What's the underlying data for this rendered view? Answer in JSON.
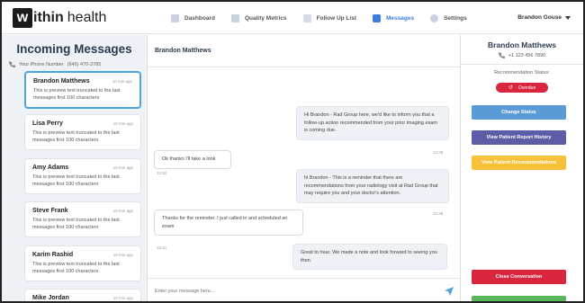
{
  "brand": {
    "logo_letter": "w",
    "logo_rest": "ithin",
    "logo_suffix": "health"
  },
  "nav": [
    {
      "label": "Dashboard",
      "icon": "dashboard-icon"
    },
    {
      "label": "Quality Metrics",
      "icon": "clipboard-icon"
    },
    {
      "label": "Follow Up List",
      "icon": "list-icon"
    },
    {
      "label": "Messages",
      "icon": "chat-icon",
      "active": true
    },
    {
      "label": "Settings",
      "icon": "gear-icon"
    }
  ],
  "user": {
    "name": "Brandon Gouse"
  },
  "inbox": {
    "title": "Incoming Messages",
    "phone_label": "Your Phone Number",
    "phone_number": "(646) 470-3785",
    "items": [
      {
        "name": "Brandon Matthews",
        "time": "10 min ago",
        "preview": "This is preview text truncated to the last messages first 100 characters"
      },
      {
        "name": "Lisa Perry",
        "time": "10 min ago",
        "preview": "This is preview text truncated to the last messages first 100 characters"
      },
      {
        "name": "Amy Adams",
        "time": "10 min ago",
        "preview": "This is preview text truncated to the last messages first 100 characters"
      },
      {
        "name": "Steve Frank",
        "time": "10 min ago",
        "preview": "This is preview text truncated to the last messages first 100 characters"
      },
      {
        "name": "Karim Rashid",
        "time": "10 min ago",
        "preview": "This is preview text truncated to the last messages first 100 characters"
      },
      {
        "name": "Mike Jordan",
        "time": "10 min ago",
        "preview": ""
      }
    ]
  },
  "chat": {
    "header": "Brandon Matthews",
    "messages": [
      {
        "dir": "out",
        "text": "Hi Brandon - Rad Group here, we'd like to inform you that a follow-up action recommended from your prior imaging exam is coming due.",
        "time": "12:35"
      },
      {
        "dir": "in",
        "text": "Ok thanks I'll take a look",
        "time": "12:32"
      },
      {
        "dir": "out",
        "text": "hi Brandon - This is a reminder that there are recommendations from your radiology visit at Rad Group that may require you and your doctor's attention.",
        "time": "12:39"
      },
      {
        "dir": "in",
        "text": "Thanks for the reminder. I just called in and scheduled an exam",
        "time": "12:41"
      },
      {
        "dir": "out",
        "text": "Great to hear. We made a note and look forward to seeing you then.",
        "time": ""
      }
    ],
    "composer_placeholder": "Enter your message here..."
  },
  "contact": {
    "name": "Brandon Matthews",
    "phone": "+1 123 456 7890",
    "rec_label": "Recommendation Status:",
    "status": "Overdue",
    "status_color": "#d7263d"
  },
  "actions": {
    "change_status": "Change Status",
    "view_history": "View Patient Report History",
    "view_recs": "View Patient Recommendations",
    "close_conversation": "Close Conversation",
    "colors": {
      "change_status": "#5b9bd5",
      "view_history": "#5b5ea6",
      "view_recs": "#f7c23a",
      "close": "#d7263d",
      "green": "#5cb85c"
    }
  }
}
